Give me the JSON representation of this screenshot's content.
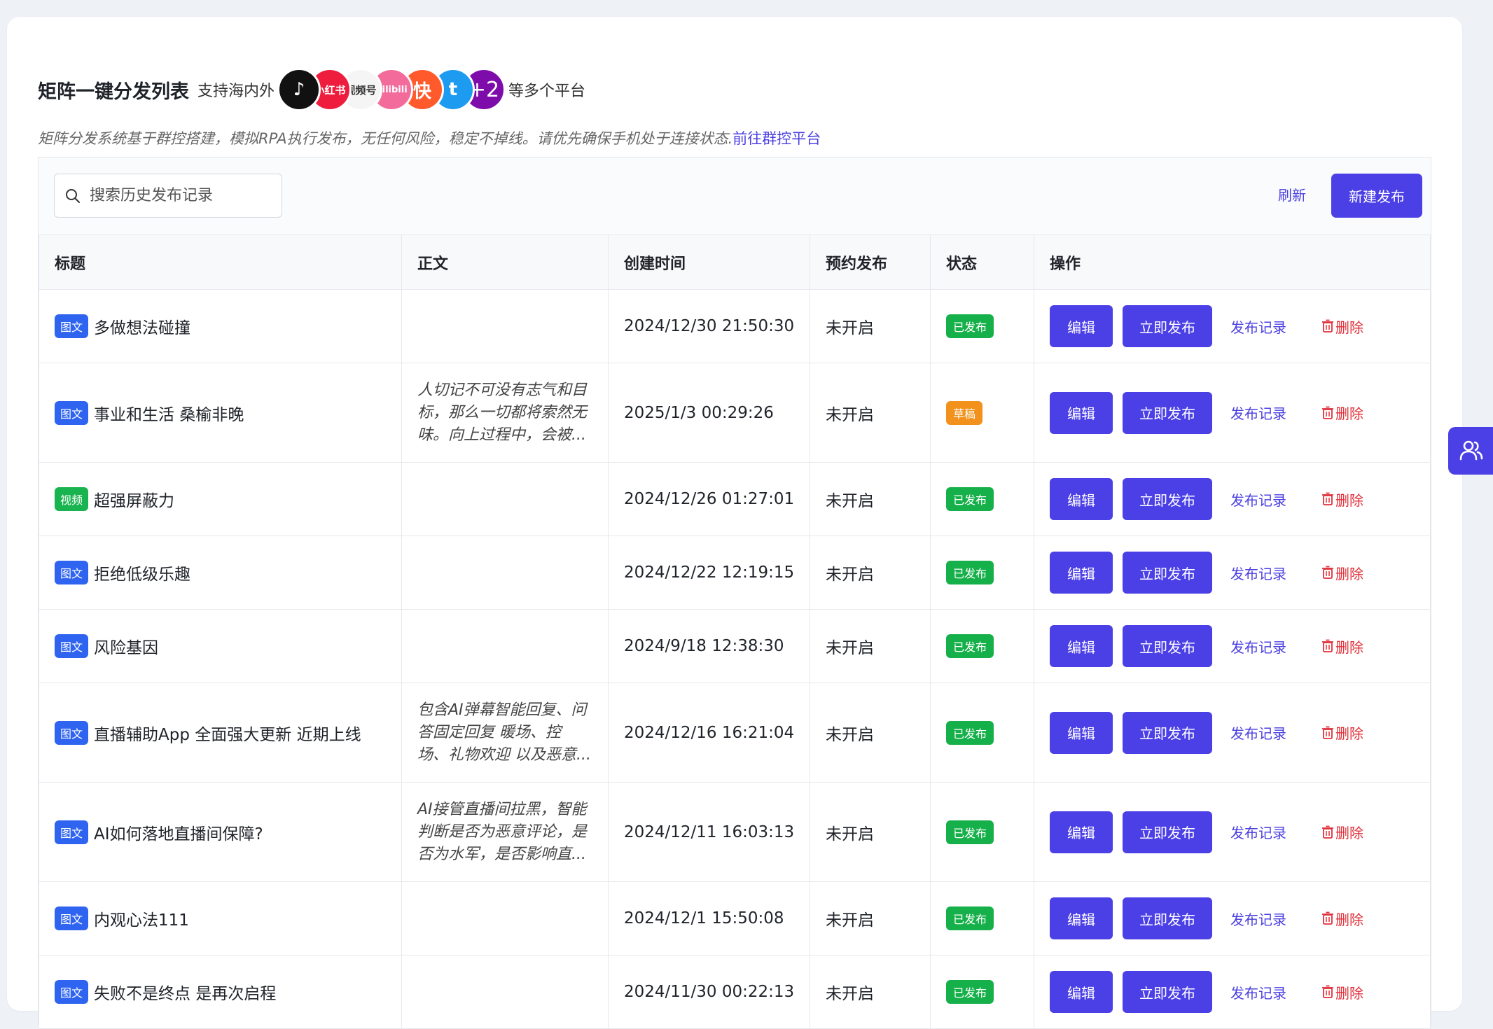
{
  "header": {
    "title": "矩阵一键分发列表",
    "support_prefix": "支持海内外",
    "platforms": [
      {
        "name": "douyin",
        "label": "♪",
        "color": "#111111"
      },
      {
        "name": "xiaohongshu",
        "label": "小红书",
        "color": "#ee1d3d"
      },
      {
        "name": "shipinhao",
        "label": "视频号",
        "color": "#f5f5f5"
      },
      {
        "name": "bilibili",
        "label": "bilibili",
        "color": "#f36b9b"
      },
      {
        "name": "kuaishou",
        "label": "快",
        "color": "#ff5a2c"
      },
      {
        "name": "twitter",
        "label": "t",
        "color": "#1d9bf0"
      }
    ],
    "more_count": "+2",
    "support_suffix": "等多个平台",
    "notice": "矩阵分发系统基于群控搭建，模拟RPA执行发布，无任何风险，稳定不掉线。请优先确保手机处于连接状态.",
    "notice_link": "前往群控平台"
  },
  "toolbar": {
    "search_placeholder": "搜索历史发布记录",
    "search_value": "",
    "refresh_label": "刷新",
    "new_label": "新建发布"
  },
  "table": {
    "columns": [
      "标题",
      "正文",
      "创建时间",
      "预约发布",
      "状态",
      "操作"
    ],
    "action_labels": {
      "edit": "编辑",
      "publish": "立即发布",
      "records": "发布记录",
      "delete": "删除"
    },
    "rows": [
      {
        "type": "图文",
        "type_kind": "imgtext",
        "title": "多做想法碰撞",
        "body": "",
        "created": "2024/12/30 21:50:30",
        "schedule": "未开启",
        "status": "已发布",
        "status_kind": "published"
      },
      {
        "type": "图文",
        "type_kind": "imgtext",
        "title": "事业和生活 桑榆非晚",
        "body": "人切记不可没有志气和目\n标，那么一切都将索然无\n味。向上过程中，会被...",
        "created": "2025/1/3 00:29:26",
        "schedule": "未开启",
        "status": "草稿",
        "status_kind": "draft"
      },
      {
        "type": "视频",
        "type_kind": "video",
        "title": "超强屏蔽力",
        "body": "",
        "created": "2024/12/26 01:27:01",
        "schedule": "未开启",
        "status": "已发布",
        "status_kind": "published"
      },
      {
        "type": "图文",
        "type_kind": "imgtext",
        "title": "拒绝低级乐趣",
        "body": "",
        "created": "2024/12/22 12:19:15",
        "schedule": "未开启",
        "status": "已发布",
        "status_kind": "published"
      },
      {
        "type": "图文",
        "type_kind": "imgtext",
        "title": "风险基因",
        "body": "",
        "created": "2024/9/18 12:38:30",
        "schedule": "未开启",
        "status": "已发布",
        "status_kind": "published"
      },
      {
        "type": "图文",
        "type_kind": "imgtext",
        "title": "直播辅助App 全面强大更新 近期上线",
        "body": "包含AI弹幕智能回复、问\n答固定回复 暖场、控\n场、礼物欢迎 以及恶意...",
        "created": "2024/12/16 16:21:04",
        "schedule": "未开启",
        "status": "已发布",
        "status_kind": "published"
      },
      {
        "type": "图文",
        "type_kind": "imgtext",
        "title": "AI如何落地直播间保障?",
        "body": "AI接管直播间拉黑，智能\n判断是否为恶意评论，是\n否为水军，是否影响直...",
        "created": "2024/12/11 16:03:13",
        "schedule": "未开启",
        "status": "已发布",
        "status_kind": "published"
      },
      {
        "type": "图文",
        "type_kind": "imgtext",
        "title": "内观心法111",
        "body": "",
        "created": "2024/12/1 15:50:08",
        "schedule": "未开启",
        "status": "已发布",
        "status_kind": "published"
      },
      {
        "type": "图文",
        "type_kind": "imgtext",
        "title": "失败不是终点 是再次启程",
        "body": "",
        "created": "2024/11/30 00:22:13",
        "schedule": "未开启",
        "status": "已发布",
        "status_kind": "published"
      }
    ]
  }
}
